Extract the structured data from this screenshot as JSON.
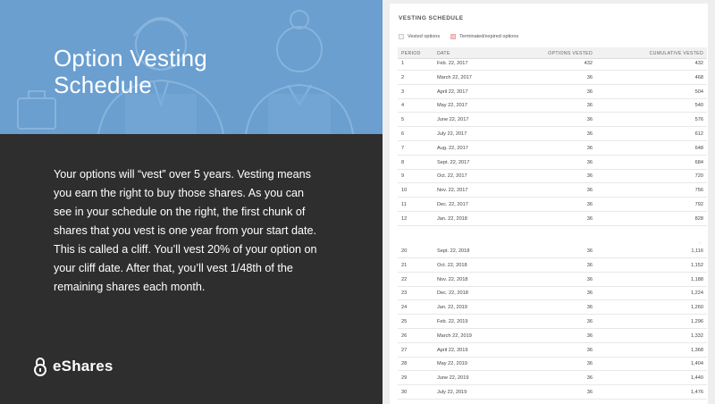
{
  "left": {
    "title_line1": "Option Vesting",
    "title_line2": "Schedule",
    "description": "Your options will “vest” over 5 years. Vesting means you earn the right to buy those shares. As you can see in your schedule on the right, the first chunk of shares that you vest is one year from your start date. This is called a cliff. You’ll vest 20% of your option on your cliff date. After that, you’ll vest 1/48th of the remaining shares each month.",
    "brand": "eShares",
    "brand_icon": "lock-icon"
  },
  "schedule": {
    "title": "VESTING SCHEDULE",
    "legend": {
      "vested": "Vested options",
      "terminated": "Terminated/expired options"
    },
    "columns": [
      "PERIOD",
      "DATE",
      "OPTIONS VESTED",
      "CUMULATIVE VESTED"
    ],
    "rows_top": [
      {
        "period": "1",
        "date": "Feb. 22, 2017",
        "vested": "432",
        "cumulative": "432"
      },
      {
        "period": "2",
        "date": "March 22, 2017",
        "vested": "36",
        "cumulative": "468"
      },
      {
        "period": "3",
        "date": "April 22, 2017",
        "vested": "36",
        "cumulative": "504"
      },
      {
        "period": "4",
        "date": "May 22, 2017",
        "vested": "36",
        "cumulative": "540"
      },
      {
        "period": "5",
        "date": "June 22, 2017",
        "vested": "36",
        "cumulative": "576"
      },
      {
        "period": "6",
        "date": "July 22, 2017",
        "vested": "36",
        "cumulative": "612"
      },
      {
        "period": "7",
        "date": "Aug. 22, 2017",
        "vested": "36",
        "cumulative": "648"
      },
      {
        "period": "8",
        "date": "Sept. 22, 2017",
        "vested": "36",
        "cumulative": "684"
      },
      {
        "period": "9",
        "date": "Oct. 22, 2017",
        "vested": "36",
        "cumulative": "720"
      },
      {
        "period": "10",
        "date": "Nov. 22, 2017",
        "vested": "36",
        "cumulative": "756"
      },
      {
        "period": "11",
        "date": "Dec. 22, 2017",
        "vested": "36",
        "cumulative": "792"
      },
      {
        "period": "12",
        "date": "Jan. 22, 2018",
        "vested": "36",
        "cumulative": "828"
      }
    ],
    "gap_marker": ".",
    "rows_bottom": [
      {
        "period": "20",
        "date": "Sept. 22, 2018",
        "vested": "36",
        "cumulative": "1,116"
      },
      {
        "period": "21",
        "date": "Oct. 22, 2018",
        "vested": "36",
        "cumulative": "1,152"
      },
      {
        "period": "22",
        "date": "Nov. 22, 2018",
        "vested": "36",
        "cumulative": "1,188"
      },
      {
        "period": "23",
        "date": "Dec. 22, 2018",
        "vested": "36",
        "cumulative": "1,224"
      },
      {
        "period": "24",
        "date": "Jan. 22, 2019",
        "vested": "36",
        "cumulative": "1,260"
      },
      {
        "period": "25",
        "date": "Feb. 22, 2019",
        "vested": "36",
        "cumulative": "1,296"
      },
      {
        "period": "26",
        "date": "March 22, 2019",
        "vested": "36",
        "cumulative": "1,332"
      },
      {
        "period": "27",
        "date": "April 22, 2019",
        "vested": "36",
        "cumulative": "1,368"
      },
      {
        "period": "28",
        "date": "May 22, 2019",
        "vested": "36",
        "cumulative": "1,404"
      },
      {
        "period": "29",
        "date": "June 22, 2019",
        "vested": "36",
        "cumulative": "1,440"
      },
      {
        "period": "30",
        "date": "July 22, 2019",
        "vested": "36",
        "cumulative": "1,476"
      }
    ]
  }
}
